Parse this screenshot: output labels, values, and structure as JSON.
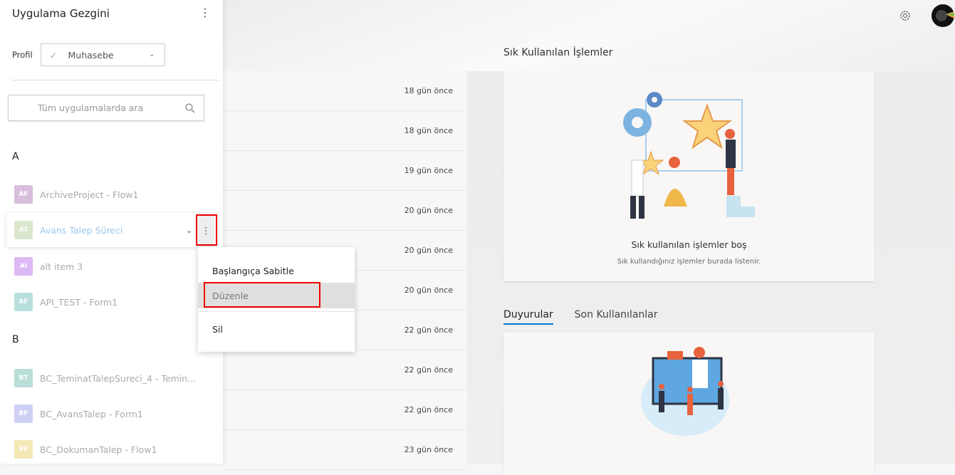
{
  "panel": {
    "title": "Uygulama Gezgini",
    "profile_label": "Profil",
    "profile_value": "Muhasebe",
    "search_placeholder": "Tüm uygulamalarda ara",
    "groups": [
      {
        "letter": "A",
        "items": [
          {
            "badge": "AF",
            "label": "ArchiveProject - Flow1",
            "color": "#d8bfdb"
          },
          {
            "badge": "AT",
            "label": "Avans Talep Süreci",
            "color": "#dbe7cd"
          },
          {
            "badge": "AI",
            "label": "alt item 3",
            "color": "#dcb9f5"
          },
          {
            "badge": "AF",
            "label": "API_TEST - Form1",
            "color": "#b9e0dc"
          }
        ]
      },
      {
        "letter": "B",
        "items": [
          {
            "badge": "BT",
            "label": "BC_TeminatTalepSureci_4 - Temin...",
            "color": "#b9ddd7"
          },
          {
            "badge": "BF",
            "label": "BC_AvansTalep - Form1",
            "color": "#cfd0f5"
          },
          {
            "badge": "BF",
            "label": "BC_DokumanTalep - Flow1",
            "color": "#f3e8b5"
          }
        ]
      }
    ]
  },
  "context_menu": {
    "items": [
      "Başlangıça Sabitle",
      "Düzenle",
      "Sil"
    ]
  },
  "recent_rows": [
    "18 gün önce",
    "18 gün önce",
    "19 gün önce",
    "20 gün önce",
    "20 gün önce",
    "20 gün önce",
    "22 gün önce",
    "22 gün önce",
    "22 gün önce",
    "23 gün önce"
  ],
  "frequent": {
    "title": "Sık Kullanılan İşlemler",
    "empty_title": "Sık kullanılan işlemler boş",
    "empty_sub": "Sık kullandığınız işlemler burada listenir."
  },
  "tabs": [
    "Duyurular",
    "Son Kullanılanlar"
  ]
}
